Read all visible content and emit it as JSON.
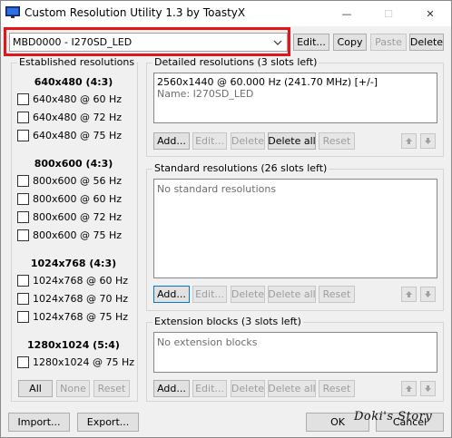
{
  "window": {
    "title": "Custom Resolution Utility 1.3 by ToastyX",
    "minimize_glyph": "—",
    "maximize_glyph": "☐",
    "close_glyph": "✕"
  },
  "monitor_select": {
    "value": "MBD0000 - I270SD_LED"
  },
  "top_buttons": {
    "edit": "Edit...",
    "copy": "Copy",
    "paste": "Paste",
    "delete": "Delete"
  },
  "established": {
    "title": "Established resolutions",
    "groups": [
      {
        "header": "640x480 (4:3)",
        "items": [
          "640x480 @ 60 Hz",
          "640x480 @ 72 Hz",
          "640x480 @ 75 Hz"
        ]
      },
      {
        "header": "800x600 (4:3)",
        "items": [
          "800x600 @ 56 Hz",
          "800x600 @ 60 Hz",
          "800x600 @ 72 Hz",
          "800x600 @ 75 Hz"
        ]
      },
      {
        "header": "1024x768 (4:3)",
        "items": [
          "1024x768 @ 60 Hz",
          "1024x768 @ 70 Hz",
          "1024x768 @ 75 Hz"
        ]
      },
      {
        "header": "1280x1024 (5:4)",
        "items": [
          "1280x1024 @ 75 Hz"
        ]
      }
    ],
    "buttons": {
      "all": "All",
      "none": "None",
      "reset": "Reset"
    }
  },
  "detailed": {
    "title": "Detailed resolutions (3 slots left)",
    "entries": [
      "2560x1440 @ 60.000 Hz (241.70 MHz) [+/-]",
      "Name: I270SD_LED"
    ],
    "buttons": {
      "add": "Add...",
      "edit": "Edit...",
      "delete": "Delete",
      "delete_all": "Delete all",
      "reset": "Reset"
    }
  },
  "standard": {
    "title": "Standard resolutions (26 slots left)",
    "empty_text": "No standard resolutions",
    "buttons": {
      "add": "Add...",
      "edit": "Edit...",
      "delete": "Delete",
      "delete_all": "Delete all",
      "reset": "Reset"
    }
  },
  "extension": {
    "title": "Extension blocks (3 slots left)",
    "empty_text": "No extension blocks",
    "buttons": {
      "add": "Add...",
      "edit": "Edit...",
      "delete": "Delete",
      "delete_all": "Delete all",
      "reset": "Reset"
    }
  },
  "footer": {
    "import": "Import...",
    "export": "Export...",
    "ok": "OK",
    "cancel": "Cancel"
  },
  "watermark": "Doki's Story",
  "colors": {
    "highlight": "#e0161a",
    "focus": "#0078d7"
  }
}
